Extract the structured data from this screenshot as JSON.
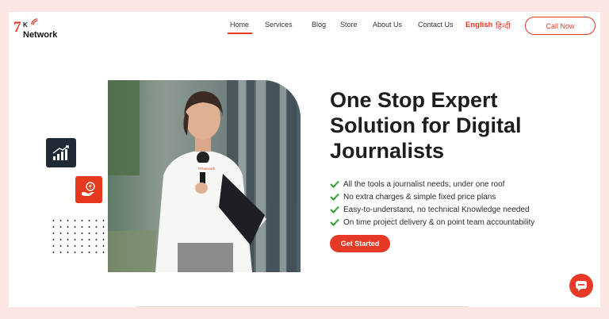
{
  "brand": {
    "seven": "7",
    "k": "K",
    "network": "Network"
  },
  "nav": {
    "items": [
      "Home",
      "Services",
      "Blog",
      "Store",
      "About Us",
      "Contact Us"
    ],
    "active": "Home"
  },
  "language": {
    "english": "English",
    "hindi": "हिन्दी"
  },
  "call_button": "Call Now",
  "hero": {
    "headline_lines": [
      "One Stop Expert",
      "Solution for Digital",
      "Journalists"
    ],
    "features": [
      "All the tools a journalist needs, under one roof",
      "No extra charges & simple fixed price plans",
      "Easy-to-understand, no technical Knowledge needed",
      "On time project delivery & on point team accountability"
    ],
    "cta": "Get Started",
    "mic_badge": "7KNetwork"
  },
  "icons": {
    "chart_tile": "bar-chart-growth-icon",
    "money_tile": "rupee-hand-icon",
    "chat": "chat-bubble-icon",
    "check": "check-icon"
  },
  "colors": {
    "accent": "#e63a26",
    "dark_tile": "#1f2a36",
    "check": "#2aa52a",
    "page_bg": "#fbe6e3"
  }
}
